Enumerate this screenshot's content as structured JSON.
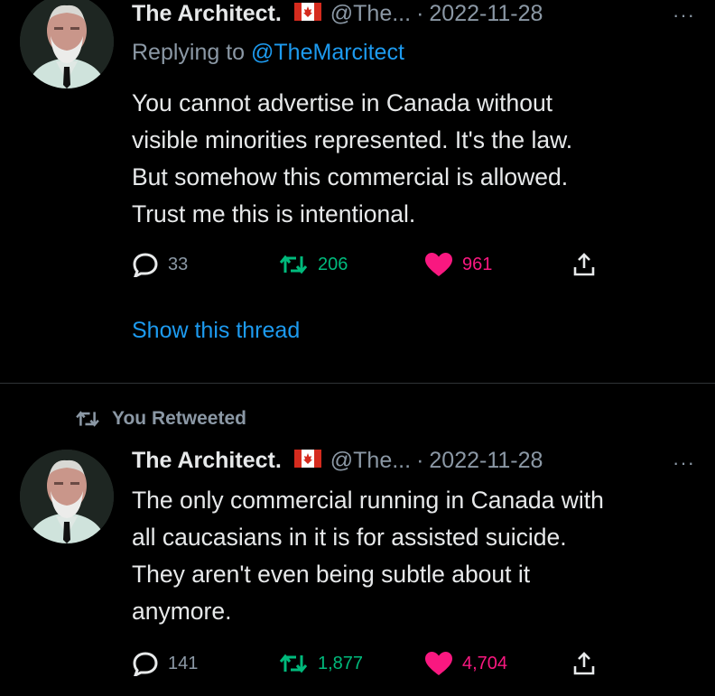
{
  "tweets": [
    {
      "author": "The Architect.",
      "flag": "canada-flag",
      "handle": "@The...",
      "separator": "·",
      "date": "2022-11-28",
      "more": "···",
      "replying_prefix": "Replying to ",
      "replying_to": "@TheMarcitect",
      "lines": [
        "You cannot advertise in Canada without",
        "visible minorities represented. It's the law.",
        "But somehow this commercial is allowed.",
        "Trust me this is intentional."
      ],
      "replies": "33",
      "retweets": "206",
      "likes": "961",
      "show_thread": "Show this thread"
    },
    {
      "social_context": "You Retweeted",
      "author": "The Architect.",
      "flag": "canada-flag",
      "handle": "@The...",
      "separator": "·",
      "date": "2022-11-28",
      "more": "···",
      "lines": [
        "The only commercial running in Canada with",
        "all caucasians in it is for assisted suicide.",
        "They aren't even being subtle about it",
        "anymore."
      ],
      "replies": "141",
      "retweets": "1,877",
      "likes": "4,704"
    }
  ],
  "colors": {
    "background": "#000000",
    "text": "#e7e9ea",
    "secondary": "#8b98a5",
    "link": "#1d9bf0",
    "retweet": "#00ba7c",
    "like": "#f91880"
  }
}
